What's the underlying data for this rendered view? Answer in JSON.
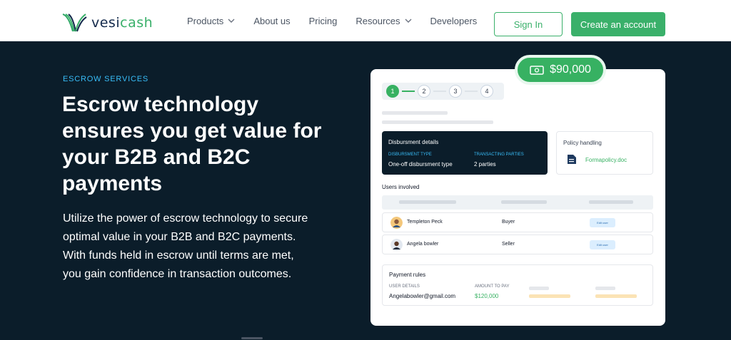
{
  "brand": {
    "name_prefix": "vesi",
    "name_suffix": "cash",
    "accent": "#3ab06a",
    "dark_bg": "#0b1d2a"
  },
  "nav": {
    "links": [
      {
        "label": "Products",
        "has_dropdown": true
      },
      {
        "label": "About us",
        "has_dropdown": false
      },
      {
        "label": "Pricing",
        "has_dropdown": false
      },
      {
        "label": "Resources",
        "has_dropdown": true
      },
      {
        "label": "Developers",
        "has_dropdown": false
      }
    ],
    "sign_in": "Sign In",
    "create_account": "Create an account"
  },
  "hero": {
    "eyebrow": "ESCROW SERVICES",
    "headline": "Escrow technology ensures you get value for your B2B and B2C payments",
    "subtext": "Utilize the power of escrow technology to secure optimal value in your B2B and B2C payments. With funds held in escrow until terms are met, you gain confidence in transaction outcomes."
  },
  "card": {
    "amount": "$90,000",
    "amount_icon": "money-icon",
    "steps": [
      "1",
      "2",
      "3",
      "4"
    ],
    "active_step": 1,
    "disbursement": {
      "title": "Disbursment details",
      "type_label": "DISBURSMENT TYPE",
      "type_value": "One-off disbursment type",
      "parties_label": "TRANSACTING PARTIES",
      "parties_value": "2 parties"
    },
    "policy": {
      "title": "Policy handling",
      "file": "Formapolicy.doc",
      "icon": "document-icon"
    },
    "users": {
      "title": "Users involved",
      "rows": [
        {
          "name": "Templeton Peck",
          "role": "Buyer",
          "action": "Edit user"
        },
        {
          "name": "Angela bowler",
          "role": "Seller",
          "action": "Edit user"
        }
      ]
    },
    "payment_rules": {
      "title": "Payment rules",
      "user_label": "USER DETAILS",
      "user_value": "Angelabowler@gmail.com",
      "amount_label": "AMOUNT TO PAY",
      "amount_value": "$120,000"
    }
  }
}
